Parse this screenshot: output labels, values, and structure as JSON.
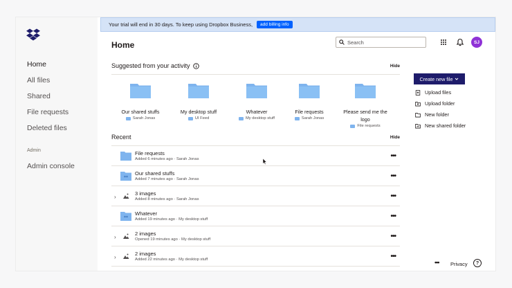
{
  "banner": {
    "text": "Your trial will end in 30 days. To keep using Dropbox Business,",
    "button": "add billing info"
  },
  "sidebar": {
    "items": [
      "Home",
      "All files",
      "Shared",
      "File requests",
      "Deleted files"
    ],
    "admin_section": "Admin",
    "admin_item": "Admin console"
  },
  "header": {
    "title": "Home",
    "search_placeholder": "Search",
    "avatar_initials": "SJ"
  },
  "suggested": {
    "title": "Suggested from your activity",
    "hide": "Hide",
    "items": [
      {
        "name": "Our shared stuffs",
        "sub": "Sarah Jonas"
      },
      {
        "name": "My desktop stuff",
        "sub": "UI Feed"
      },
      {
        "name": "Whatever",
        "sub": "My desktop stuff"
      },
      {
        "name": "File requests",
        "sub": "Sarah Jonas"
      },
      {
        "name": "Please send me the logo",
        "sub": "File requests"
      }
    ]
  },
  "recent": {
    "title": "Recent",
    "hide": "Hide",
    "rows": [
      {
        "name": "File requests",
        "meta": "Added 6 minutes ago · Sarah Jonas",
        "kind": "folder"
      },
      {
        "name": "Our shared stuffs",
        "meta": "Added 7 minutes ago · Sarah Jonas",
        "kind": "shared-folder"
      },
      {
        "name": "3 images",
        "meta": "Added 8 minutes ago · Sarah Jonas",
        "kind": "images"
      },
      {
        "name": "Whatever",
        "meta": "Added 19 minutes ago · My desktop stuff",
        "kind": "shared-folder"
      },
      {
        "name": "2 images",
        "meta": "Opened 19 minutes ago · My desktop stuff",
        "kind": "images"
      },
      {
        "name": "2 images",
        "meta": "Added 22 minutes ago · My desktop stuff",
        "kind": "images"
      }
    ],
    "more": "•••"
  },
  "actions": {
    "create": "Create new file",
    "items": [
      "Upload files",
      "Upload folder",
      "New folder",
      "New shared folder"
    ]
  },
  "footer": {
    "more": "•••",
    "privacy": "Privacy",
    "help": "?"
  },
  "colors": {
    "accent": "#0061fe",
    "folder": "#7fb4ee",
    "create": "#1e1c6b",
    "avatar": "#8f32d6",
    "banner": "#d5e3f7"
  }
}
